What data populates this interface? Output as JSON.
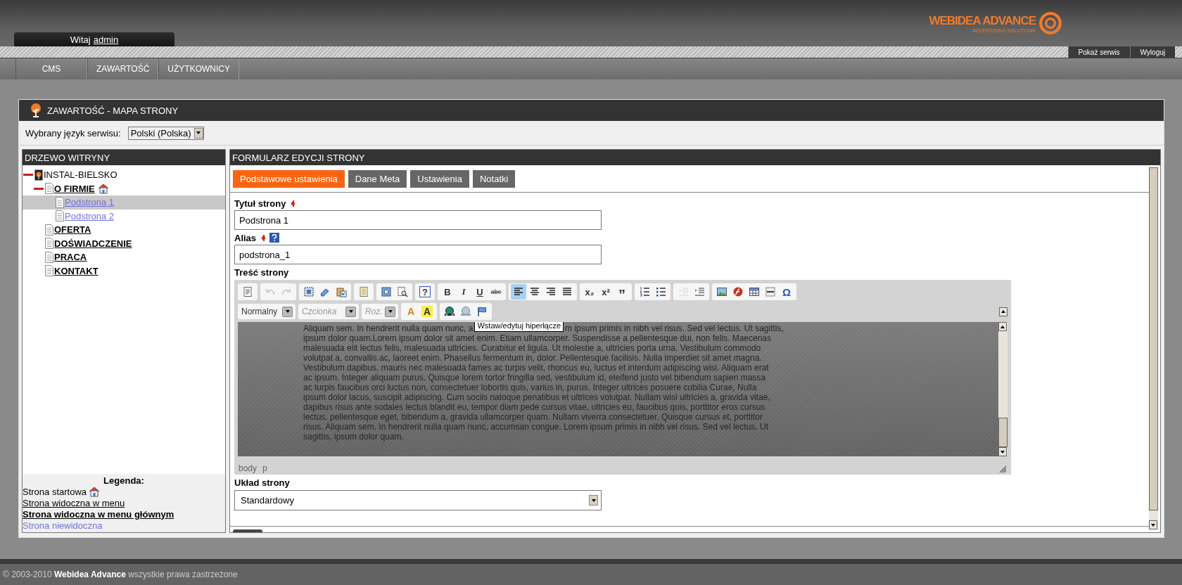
{
  "header": {
    "welcome": "Witaj",
    "user": "admin",
    "logo_title": "WEBIDEA ADVANCE",
    "logo_subtitle": "ADVERTISING SOLUTIONS"
  },
  "top_links": [
    "Pokaż serwis",
    "Wyloguj"
  ],
  "nav": [
    "CMS",
    "ZAWARTOŚĆ",
    "UŻYTKOWNICY"
  ],
  "page": {
    "title": "ZAWARTOŚĆ - MAPA STRONY",
    "language_label": "Wybrany język serwisu:",
    "language_value": "Polski (Polska)"
  },
  "tree": {
    "title": "DRZEWO WITRYNY",
    "nodes": [
      {
        "label": "INSTAL-BIELSKO",
        "kind": "root",
        "expanded": true,
        "selected": false,
        "home": false,
        "children": [
          {
            "label": "O FIRMIE",
            "kind": "main",
            "expanded": true,
            "selected": false,
            "home": true,
            "children": [
              {
                "label": "Podstrona 1",
                "kind": "hidden",
                "selected": true,
                "home": false
              },
              {
                "label": "Podstrona 2",
                "kind": "hidden",
                "selected": false,
                "home": false
              }
            ]
          },
          {
            "label": "OFERTA",
            "kind": "main",
            "selected": false,
            "home": false
          },
          {
            "label": "DOŚWIADCZENIE",
            "kind": "main",
            "selected": false,
            "home": false
          },
          {
            "label": "PRACA",
            "kind": "main",
            "selected": false,
            "home": false
          },
          {
            "label": "KONTAKT",
            "kind": "main",
            "selected": false,
            "home": false
          }
        ]
      }
    ]
  },
  "legend": {
    "title": "Legenda:",
    "items": [
      {
        "label": "Strona startowa",
        "kind": "home"
      },
      {
        "label": "Strona widoczna w menu",
        "kind": "menu"
      },
      {
        "label": "Strona widoczna w menu głównym",
        "kind": "main"
      },
      {
        "label": "Strona niewidoczna",
        "kind": "hidden"
      }
    ]
  },
  "form": {
    "title": "FORMULARZ EDYCJI STRONY",
    "tabs": [
      {
        "label": "Podstawowe ustawienia",
        "selected": true
      },
      {
        "label": "Dane Meta",
        "selected": false
      },
      {
        "label": "Ustawienia",
        "selected": false
      },
      {
        "label": "Notatki",
        "selected": false
      }
    ],
    "page_title": {
      "label": "Tytuł strony",
      "required": true,
      "value": "Podstrona 1"
    },
    "alias": {
      "label": "Alias",
      "required": true,
      "value": "podstrona_1"
    },
    "content_label": "Treść strony",
    "toolbar_row1": [
      [
        {
          "kind": "doc"
        }
      ],
      [
        {
          "kind": "undo",
          "disabled": true
        },
        {
          "kind": "redo",
          "disabled": true
        }
      ],
      [
        {
          "kind": "selectall"
        },
        {
          "kind": "eraser"
        },
        {
          "kind": "paste"
        }
      ],
      [
        {
          "kind": "template"
        }
      ],
      [
        {
          "kind": "preview"
        },
        {
          "kind": "find"
        }
      ],
      [
        {
          "kind": "help",
          "label": "?"
        }
      ],
      [
        {
          "kind": "bold",
          "label": "B"
        },
        {
          "kind": "italic",
          "label": "I"
        },
        {
          "kind": "underline",
          "label": "U"
        },
        {
          "kind": "strike",
          "label": "abc"
        }
      ],
      [
        {
          "kind": "align-left",
          "on": true
        },
        {
          "kind": "align-center",
          "on": false
        },
        {
          "kind": "align-right",
          "on": false
        },
        {
          "kind": "align-justify",
          "on": false
        }
      ],
      [
        {
          "kind": "sub",
          "label": "x₂"
        },
        {
          "kind": "sup",
          "label": "x²"
        },
        {
          "kind": "quote",
          "label": "”"
        }
      ],
      [
        {
          "kind": "ol"
        },
        {
          "kind": "ul"
        }
      ],
      [
        {
          "kind": "outdent",
          "disabled": true
        },
        {
          "kind": "indent"
        }
      ],
      [
        {
          "kind": "image"
        },
        {
          "kind": "flash"
        },
        {
          "kind": "table"
        },
        {
          "kind": "hr"
        },
        {
          "kind": "omega",
          "label": "Ω"
        }
      ]
    ],
    "format_select": "Normalny",
    "font_select": "Czcionka",
    "size_select": "Roz.",
    "text_color": "A",
    "bg_color": "A",
    "link_buttons": [
      {
        "kind": "link"
      },
      {
        "kind": "unlink"
      },
      {
        "kind": "anchor"
      }
    ],
    "tooltip": "Wstaw/edytuj hiperłącze",
    "content_line_left": "Aliquam sem. In hendrerit nulla quam nunc, a",
    "content_line_right": "m ipsum primis in nibh vel risus. Sed vel lectus. Ut sagittis,",
    "content_rest": "ipsum dolor quam.Lorem ipsum dolor sit amet enim. Etiam ullamcorper. Suspendisse a pellentesque dui, non felis. Maecenas malesuada elit lectus felis, malesuada ultricies. Curabitur et ligula. Ut molestie a, ultricies porta urna. Vestibulum commodo volutpat a, convallis ac, laoreet enim. Phasellus fermentum in, dolor. Pellentesque facilisis. Nulla imperdiet sit amet magna. Vestibulum dapibus, mauris nec malesuada fames ac turpis velit, rhoncus eu, luctus et interdum adipiscing wisi. Aliquam erat ac ipsum. Integer aliquam purus. Quisque lorem tortor fringilla sed, vestibulum id, eleifend justo vel bibendum sapien massa ac turpis faucibus orci luctus non, consectetuer lobortis quis, varius in, purus. Integer ultrices posuere cubilia Curae, Nulla ipsum dolor lacus, suscipit adipiscing. Cum sociis natoque penatibus et ultrices volutpat. Nullam wisi ultricies a, gravida vitae, dapibus risus ante sodales lectus blandit eu, tempor diam pede cursus vitae, ultricies eu, faucibus quis, porttitor eros cursus lectus, pellentesque eget, bibendum a, gravida ullamcorper quam. Nullam viverra consectetuer. Quisque cursus et, porttitor risus. Aliquam sem. In hendrerit nulla quam nunc, accumsan congue. Lorem ipsum primis in nibh vel risus. Sed vel lectus. Ut sagittis, ipsum dolor quam.",
    "path": [
      "body",
      "p"
    ],
    "layout": {
      "label": "Układ strony",
      "value": "Standardowy"
    }
  },
  "footer": "© 2003-2010 **Webidea Advance** wszystkie prawa zastrzeżone"
}
